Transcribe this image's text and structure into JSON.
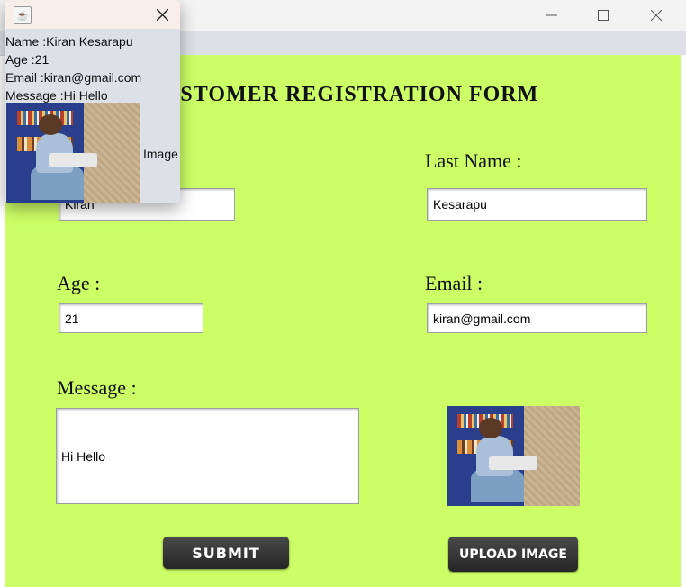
{
  "form": {
    "title": "CUSTOMER REGISTRATION FORM",
    "first_name_value": "Kiran",
    "last_name_label": "Last Name :",
    "last_name_value": "Kesarapu",
    "age_label": "Age :",
    "age_value": "21",
    "email_label": "Email :",
    "email_value": "kiran@gmail.com",
    "message_label": "Message :",
    "message_value": "Hi Hello",
    "submit_label": "SUBMIT",
    "upload_label": "UPLOAD IMAGE"
  },
  "popup": {
    "name_line": "Name :Kiran Kesarapu",
    "age_line": "Age :21",
    "email_line": "Email :kiran@gmail.com",
    "message_line": "Message :Hi Hello",
    "image_label": "Image"
  },
  "window_controls": {
    "minimize": "—",
    "maximize": "☐",
    "close": "✕"
  },
  "colors": {
    "form_background": "#ccff66",
    "button_background": "#333333"
  }
}
